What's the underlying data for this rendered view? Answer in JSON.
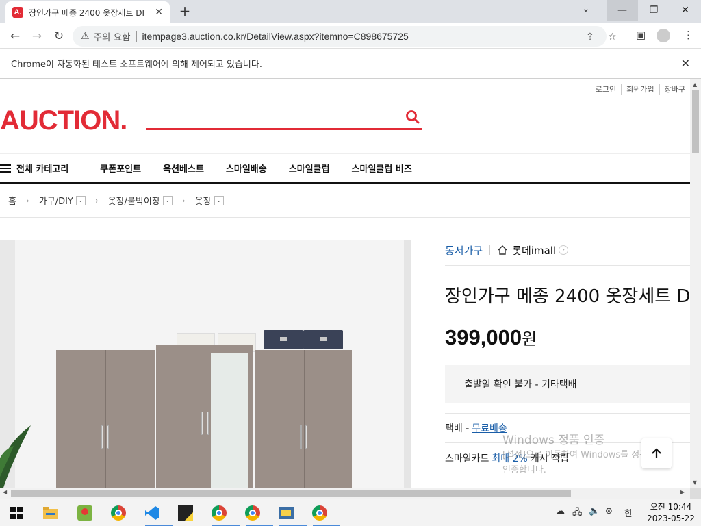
{
  "browser": {
    "tab_title": "장인가구 메종 2400 옷장세트 DI",
    "tab_favicon": "A.",
    "address": {
      "security_label": "주의 요함",
      "url": "itempage3.auction.co.kr/DetailView.aspx?itemno=C898675725"
    },
    "infobar_text": "Chrome이 자동화된 테스트 소프트웨어에 의해 제어되고 있습니다."
  },
  "site": {
    "util_links": [
      "로그인",
      "회원가입",
      "장바구"
    ],
    "logo": "AUCTION.",
    "nav": {
      "all_category": "전체 카테고리",
      "items": [
        "쿠폰포인트",
        "옥션베스트",
        "스마일배송",
        "스마일클럽",
        "스마일클럽 비즈"
      ]
    },
    "breadcrumb": [
      "홈",
      "가구/DIY",
      "옷장/붙박이장",
      "옷장"
    ]
  },
  "product": {
    "seller": "동서가구",
    "store": "롯데imall",
    "title": "장인가구 메종 2400 옷장세트 D",
    "price": "399,000",
    "currency": "원",
    "shipping_notice": "출발일 확인 불가 - 기타택배",
    "delivery_label": "택배 -",
    "delivery_value": "무료배송",
    "smilecard_label": "스마일카드",
    "smilecard_value": "최대 2%",
    "smilecard_suffix": "캐시 적립"
  },
  "watermark": {
    "line1": "Windows 정품 인증",
    "line2": "[설정]으로 이동하여 Windows를 정품",
    "line3": "인증합니다."
  },
  "taskbar": {
    "time": "오전 10:44",
    "date": "2023-05-22",
    "ime": "한"
  },
  "colors": {
    "brand_red": "#e22b36",
    "link_blue": "#1a5ea8",
    "tab_bar": "#dee1e6"
  }
}
